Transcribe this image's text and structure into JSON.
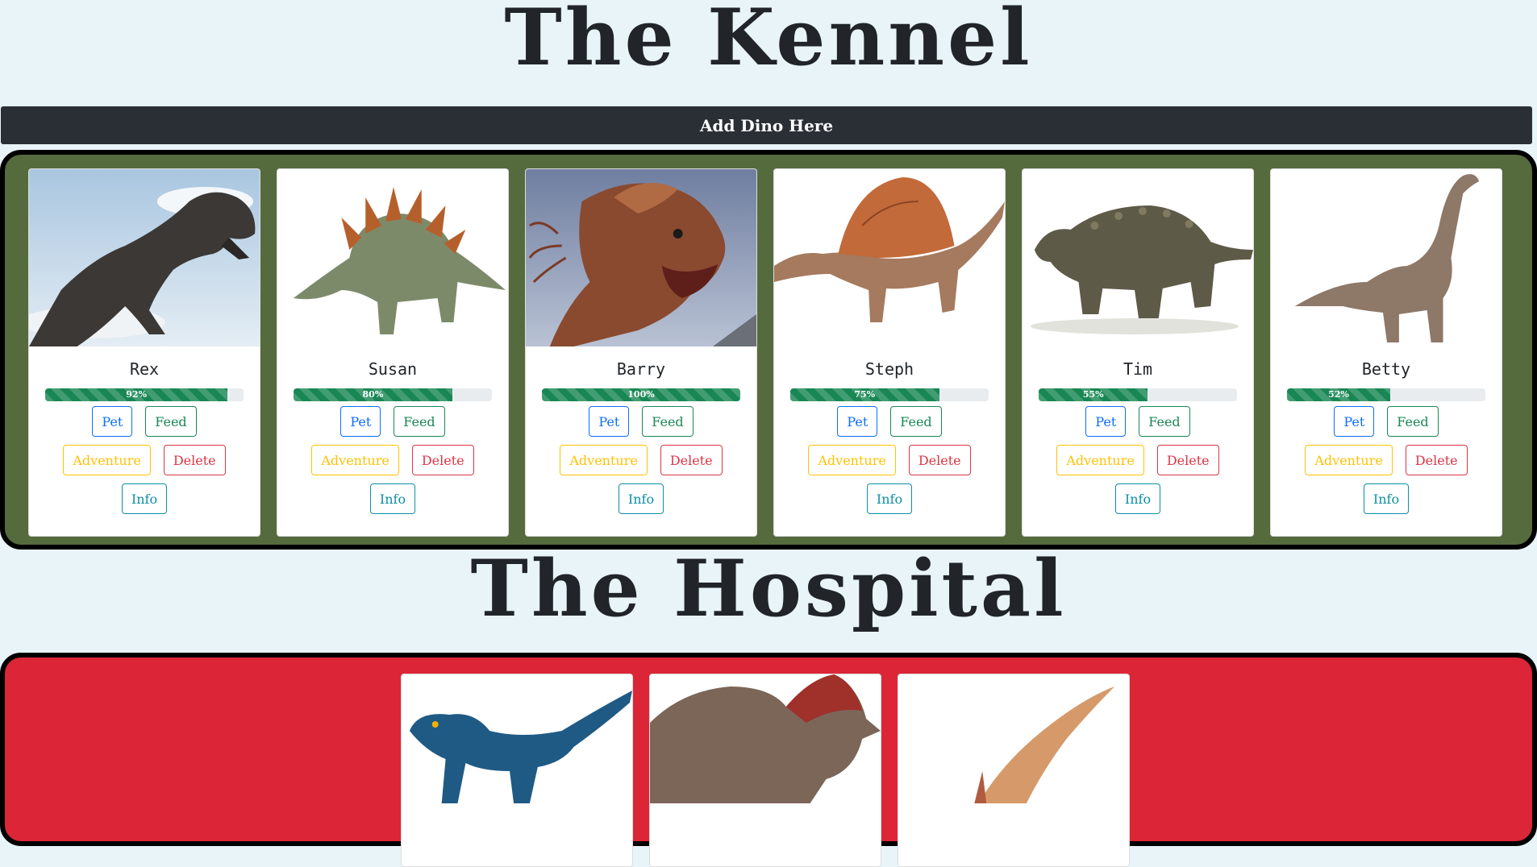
{
  "kennel": {
    "title": "The Kennel",
    "add_button_label": "Add Dino Here",
    "buttons": {
      "pet": "Pet",
      "feed": "Feed",
      "adventure": "Adventure",
      "delete": "Delete",
      "info": "Info"
    },
    "dinos": [
      {
        "name": "Rex",
        "health": 92,
        "health_label": "92%",
        "image": "t-rex-image"
      },
      {
        "name": "Susan",
        "health": 80,
        "health_label": "80%",
        "image": "stegosaurus-image"
      },
      {
        "name": "Barry",
        "health": 100,
        "health_label": "100%",
        "image": "dilophosaurus-image"
      },
      {
        "name": "Steph",
        "health": 75,
        "health_label": "75%",
        "image": "spinosaurus-image"
      },
      {
        "name": "Tim",
        "health": 55,
        "health_label": "55%",
        "image": "ankylosaurus-image"
      },
      {
        "name": "Betty",
        "health": 52,
        "health_label": "52%",
        "image": "brachiosaurus-image"
      }
    ]
  },
  "hospital": {
    "title": "The Hospital",
    "dinos": [
      {
        "image": "velociraptor-image"
      },
      {
        "image": "triceratops-image"
      },
      {
        "image": "pteranodon-image"
      }
    ]
  },
  "colors": {
    "page_bg": "#e8f4f8",
    "kennel_bg": "#556b3e",
    "hospital_bg": "#dc2637",
    "bar_fill": "#198754",
    "add_bar_bg": "#2a2f36"
  }
}
